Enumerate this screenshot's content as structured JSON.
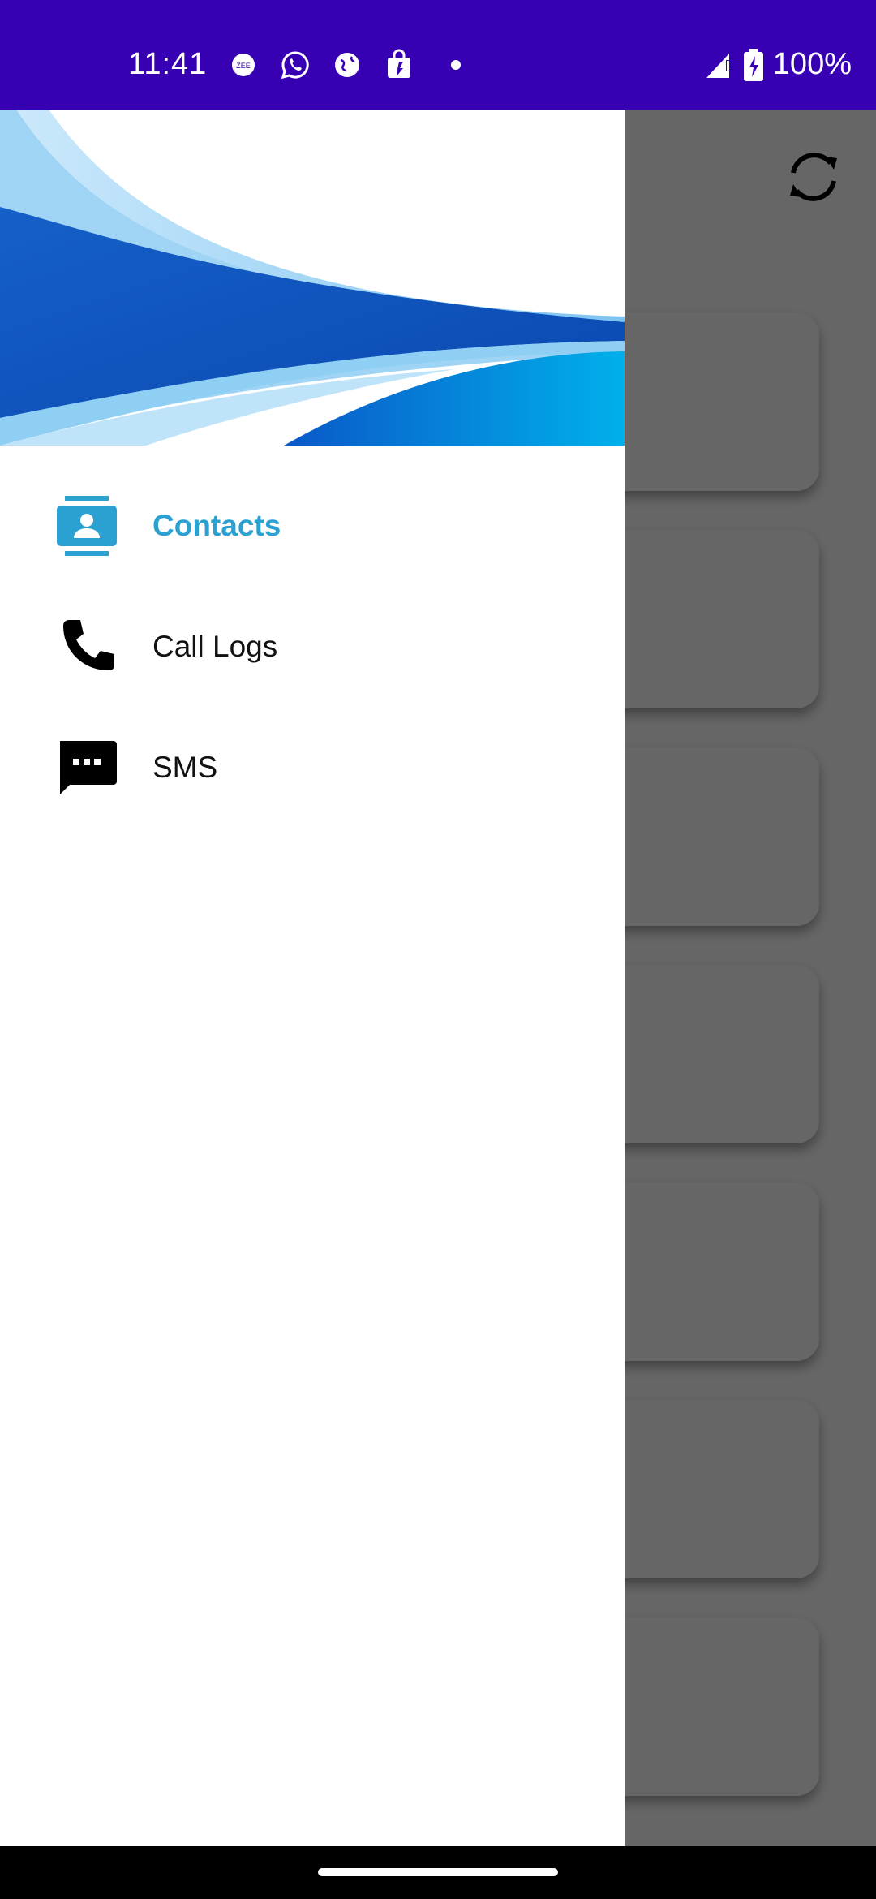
{
  "status_bar": {
    "time": "11:41",
    "battery": "100%",
    "icons": [
      "zee5-icon",
      "whatsapp-icon",
      "globe-icon",
      "shopping-bag-icon",
      "notification-dot-icon",
      "signal-icon",
      "battery-charging-icon"
    ]
  },
  "drawer": {
    "items": [
      {
        "label": "Contacts",
        "icon": "contacts-icon",
        "active": true
      },
      {
        "label": "Call Logs",
        "icon": "phone-icon",
        "active": false
      },
      {
        "label": "SMS",
        "icon": "sms-icon",
        "active": false
      }
    ]
  },
  "colors": {
    "status_bar": "#3700b3",
    "active_accent": "#2aa1d0",
    "scrim": "rgba(0,0,0,0.6)"
  }
}
